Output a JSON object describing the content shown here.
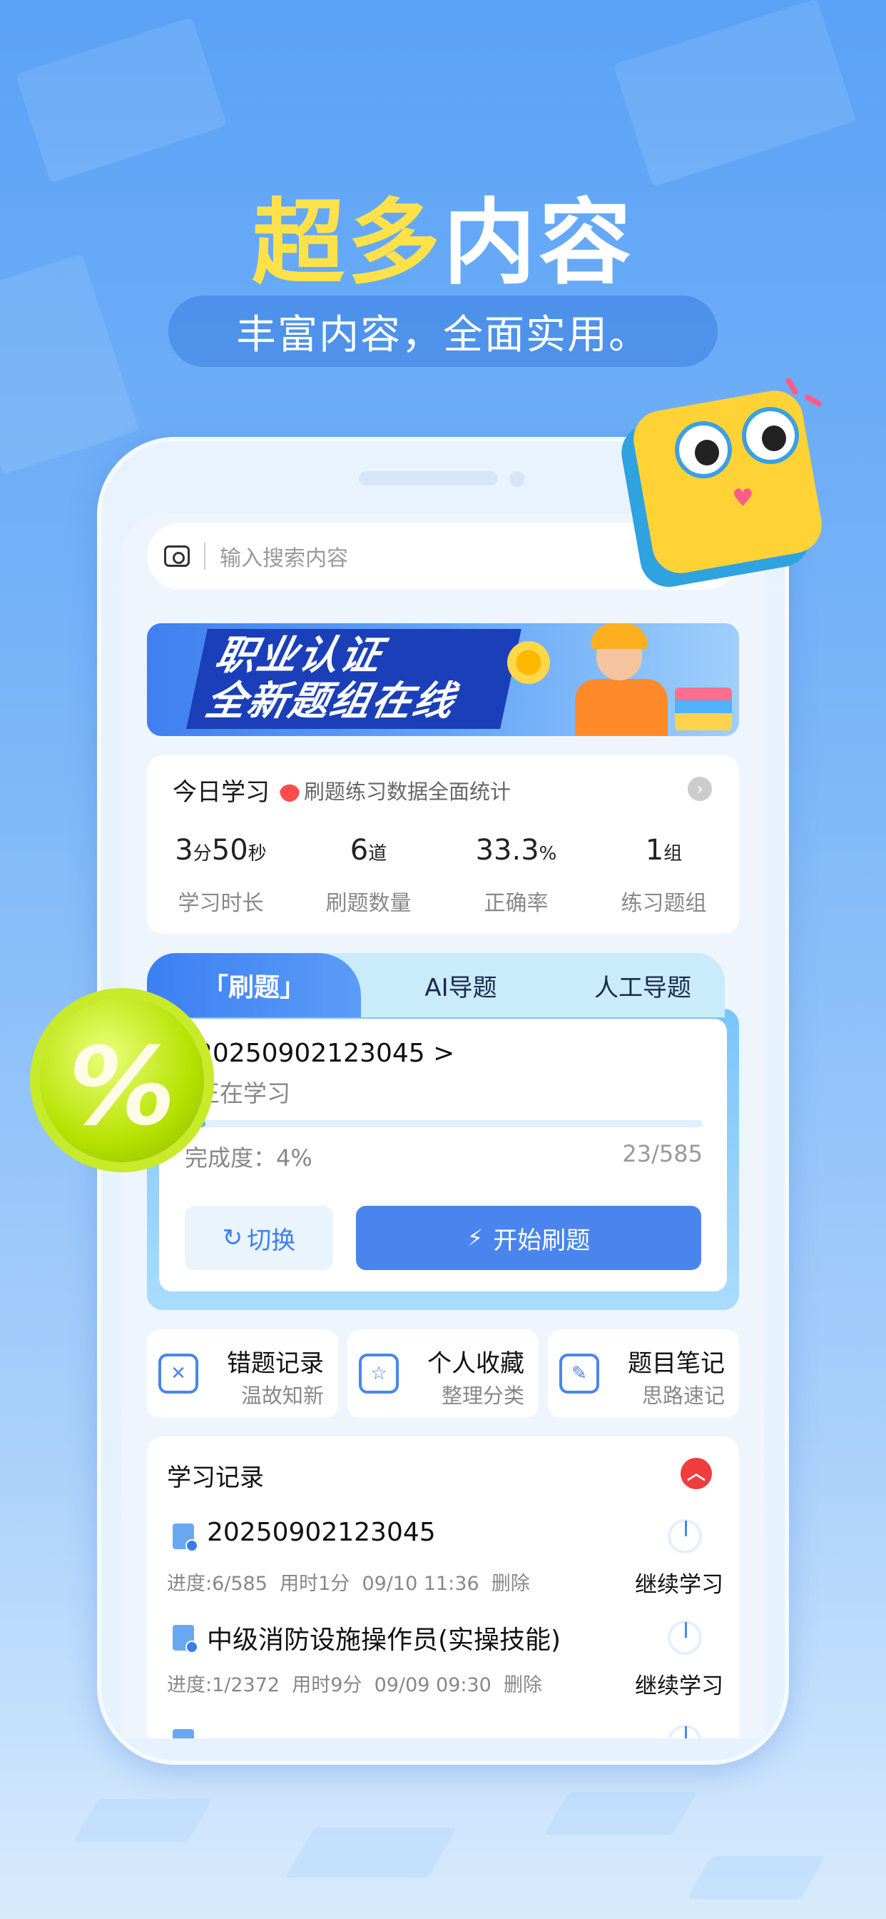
{
  "headline": {
    "part1": "超多",
    "part2": "内容"
  },
  "subtitle": "丰富内容，全面实用。",
  "search": {
    "placeholder": "输入搜索内容"
  },
  "banner": {
    "line1": "职业认证",
    "line2": "全新题组在线"
  },
  "today": {
    "title": "今日学习",
    "hot": "HOT",
    "desc": "刷题练习数据全面统计",
    "stats": [
      {
        "value_main": "3",
        "unit1": "分",
        "value_sub": "50",
        "unit2": "秒",
        "label": "学习时长"
      },
      {
        "value_main": "6",
        "unit1": "道",
        "label": "刷题数量"
      },
      {
        "value_main": "33.3",
        "unit1": "%",
        "label": "正确率"
      },
      {
        "value_main": "1",
        "unit1": "组",
        "label": "练习题组"
      }
    ]
  },
  "practice": {
    "tabs": [
      "「刷题」",
      "AI导题",
      "人工导题"
    ],
    "active_tab": 0,
    "code": "20250902123045 >",
    "state": "正在学习",
    "progress_label": "完成度：4%",
    "progress_fraction": 0.04,
    "count": "23/585",
    "switch_label": "切换",
    "start_label": "开始刷题"
  },
  "tools": [
    {
      "name": "错题记录",
      "sub": "温故知新",
      "icon": "wrong-questions-icon"
    },
    {
      "name": "个人收藏",
      "sub": "整理分类",
      "icon": "favorites-star-icon"
    },
    {
      "name": "题目笔记",
      "sub": "思路速记",
      "icon": "notes-edit-icon"
    }
  ],
  "records": {
    "title": "学习记录",
    "items": [
      {
        "name": "20250902123045",
        "progress": "进度:6/585",
        "time": "用时1分",
        "date": "09/10 11:36",
        "delete": "删除",
        "action": "继续学习"
      },
      {
        "name": "中级消防设施操作员(实操技能)",
        "progress": "进度:1/2372",
        "time": "用时9分",
        "date": "09/09 09:30",
        "delete": "删除",
        "action": "继续学习"
      }
    ]
  },
  "colors": {
    "accent": "#4a85ee",
    "headline_yellow": "#ffe24a",
    "record_badge": "#ef3d3d"
  }
}
